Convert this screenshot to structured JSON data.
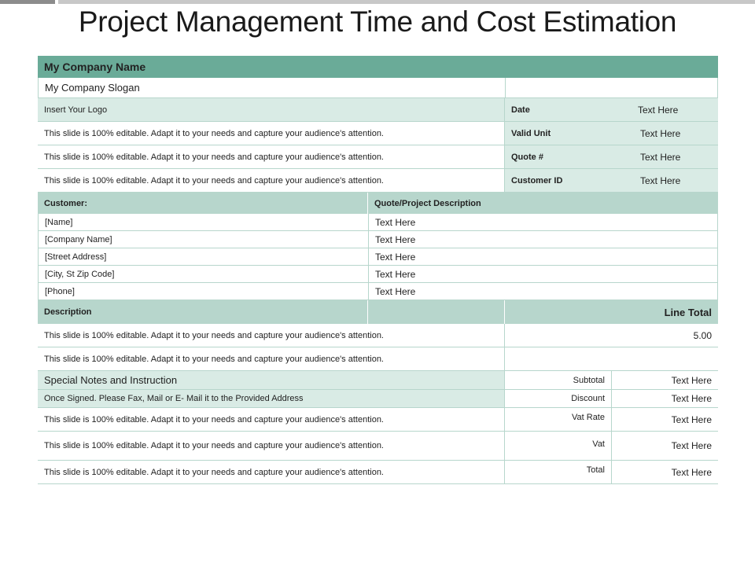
{
  "title": "Project Management Time and Cost Estimation",
  "company": {
    "name": "My Company  Name",
    "slogan": "My Company  Slogan",
    "logo": "Insert Your Logo"
  },
  "header_rows": [
    {
      "text": "This slide is 100% editable. Adapt it to your needs and capture your audience's attention.",
      "label": "Valid Unit",
      "value": "Text Here"
    },
    {
      "text": "This slide is 100% editable. Adapt it to your needs and capture your audience's attention.",
      "label": "Quote #",
      "value": "Text Here"
    },
    {
      "text": "This slide is 100% editable. Adapt it to your needs and capture your audience's attention.",
      "label": "Customer ID",
      "value": "Text Here"
    }
  ],
  "date": {
    "label": "Date",
    "value": "Text Here"
  },
  "customer": {
    "header": "Customer:",
    "desc_header": "Quote/Project  Description",
    "rows": [
      {
        "field": "[Name]",
        "value": "Text Here"
      },
      {
        "field": "[Company Name]",
        "value": "Text Here"
      },
      {
        "field": "[Street Address]",
        "value": "Text Here"
      },
      {
        "field": "[City,  St Zip Code]",
        "value": "Text Here"
      },
      {
        "field": "[Phone]",
        "value": "Text Here"
      }
    ]
  },
  "items": {
    "desc_header": "Description",
    "total_header": "Line Total",
    "rows": [
      {
        "text": "This slide is 100% editable. Adapt it to your needs and capture your audience's attention.",
        "total": "5.00"
      },
      {
        "text": "This slide is 100% editable. Adapt it to your needs and capture your audience's attention.",
        "total": ""
      }
    ]
  },
  "notes": {
    "header": "Special Notes and Instruction",
    "instruction": "Once Signed. Please Fax, Mail or E- Mail it to the Provided Address",
    "rows": [
      "This slide is 100% editable. Adapt it to your needs and capture your audience's attention.",
      "This slide is 100% editable. Adapt it to your needs and capture your audience's attention.",
      "This slide is 100% editable. Adapt it to your needs and capture your audience's attention."
    ]
  },
  "summary": [
    {
      "label": "Subtotal",
      "value": "Text Here"
    },
    {
      "label": "Discount",
      "value": "Text Here"
    },
    {
      "label": "Vat Rate",
      "value": "Text Here"
    },
    {
      "label": "Vat",
      "value": "Text Here"
    },
    {
      "label": "Total",
      "value": "Text Here"
    }
  ],
  "colors": {
    "header": "#6aab98",
    "subheader": "#b7d6cc",
    "band": "#d9ebe5"
  }
}
